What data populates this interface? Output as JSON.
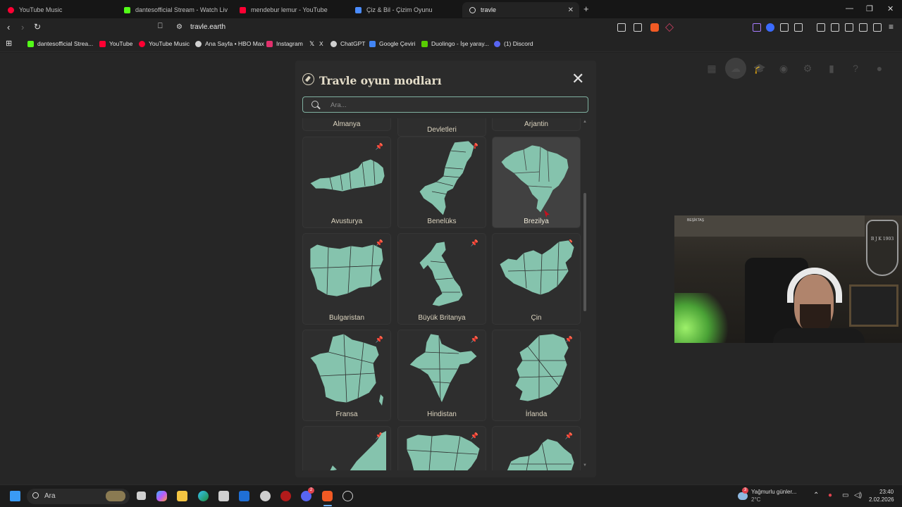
{
  "browser": {
    "tabs": [
      {
        "title": "YouTube Music",
        "color": "#ff0033"
      },
      {
        "title": "dantesofficial Stream - Watch Liv",
        "color": "#53fc18"
      },
      {
        "title": "mendebur lemur - YouTube",
        "color": "#ff0033"
      },
      {
        "title": "Çiz & Bil - Çizim Oyunu",
        "color": "#4a8cff"
      },
      {
        "title": "travle",
        "color": "#dddddd"
      }
    ],
    "url": "travle.earth",
    "bookmarks": [
      {
        "label": "dantesofficial Strea...",
        "color": "#53fc18"
      },
      {
        "label": "YouTube",
        "color": "#ff0033"
      },
      {
        "label": "YouTube Music",
        "color": "#ff0033"
      },
      {
        "label": "Ana Sayfa • HBO Max",
        "color": "#d0d0d0"
      },
      {
        "label": "Instagram",
        "color": "#e1306c"
      },
      {
        "label": "X",
        "color": "#ffffff"
      },
      {
        "label": "ChatGPT",
        "color": "#cfcfcf"
      },
      {
        "label": "Google Çeviri",
        "color": "#4285f4"
      },
      {
        "label": "Duolingo - İşe yaray...",
        "color": "#58cc02"
      },
      {
        "label": "(1) Discord",
        "color": "#5865f2"
      }
    ]
  },
  "modal": {
    "title": "Travle oyun modları",
    "search_placeholder": "Ara...",
    "partial_top": [
      "Almanya",
      "Devletleri",
      "Arjantin"
    ],
    "cards": [
      {
        "label": "Avusturya",
        "shape": "austria"
      },
      {
        "label": "Benelüks",
        "shape": "benelux"
      },
      {
        "label": "Brezilya",
        "shape": "brazil",
        "hover": true
      },
      {
        "label": "Bulgaristan",
        "shape": "bulgaria"
      },
      {
        "label": "Büyük Britanya",
        "shape": "uk"
      },
      {
        "label": "Çin",
        "shape": "china"
      },
      {
        "label": "Fransa",
        "shape": "france"
      },
      {
        "label": "Hindistan",
        "shape": "india"
      },
      {
        "label": "İrlanda",
        "shape": "ireland"
      },
      {
        "label": "",
        "shape": "norway"
      },
      {
        "label": "",
        "shape": "spain"
      },
      {
        "label": "",
        "shape": "south-america"
      }
    ],
    "map_color": "#85c3ad"
  },
  "taskbar": {
    "search_label": "Ara",
    "weather_text": "Yağmurlu günler...",
    "temperature": "2°C",
    "time": "23:40",
    "date": "2.02.2026",
    "weather_badge": "3",
    "discord_badge": "2"
  },
  "webcam": {
    "banner_text": "BEŞİKTAŞ",
    "crest_text": "B J K 1903"
  }
}
